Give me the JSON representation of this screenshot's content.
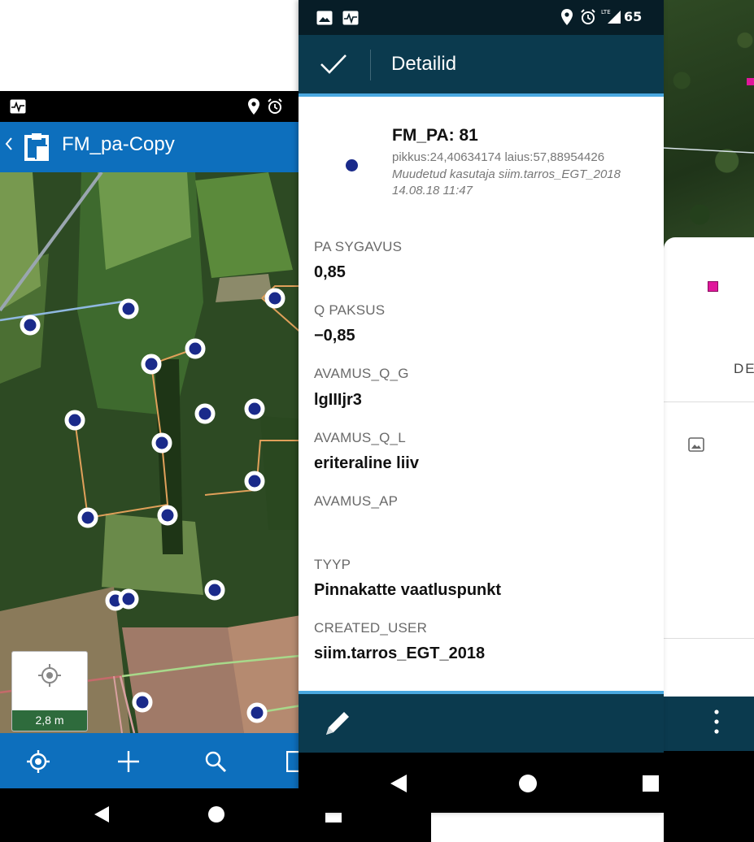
{
  "left_app": {
    "title": "FM_pa-Copy",
    "scale_label": "2,8 m",
    "icons": [
      "locate-icon",
      "plus-icon",
      "search-icon",
      "layers-icon"
    ]
  },
  "middle_app": {
    "status_battery": "65",
    "title": "Detailid",
    "feature": {
      "name": "FM_PA: 81",
      "coords": "pikkus:24,40634174 laius:57,88954426",
      "edited_by": "Muudetud kasutaja siim.tarros_EGT_2018",
      "edited_at": "14.08.18 11:47"
    },
    "fields": [
      {
        "label": "PA SYGAVUS",
        "value": "0,85"
      },
      {
        "label": "Q PAKSUS",
        "value": "−0,85"
      },
      {
        "label": "AVAMUS_Q_G",
        "value": "lgIIIjr3"
      },
      {
        "label": "AVAMUS_Q_L",
        "value": "eriteraline liiv"
      },
      {
        "label": "AVAMUS_AP",
        "value": ""
      },
      {
        "label": "TYYP",
        "value": "Pinnakatte vaatluspunkt"
      },
      {
        "label": "CREATED_USER",
        "value": "siim.tarros_EGT_2018"
      }
    ]
  },
  "right_app": {
    "partial_tab_label": "DE"
  },
  "colors": {
    "left_blue": "#0d6fbd",
    "dark_teal": "#0b3a4e",
    "accent_line": "#4aa8e0",
    "point_navy": "#1a2a8a",
    "magenta_point": "#e0179c",
    "line_orange": "#e0a05a"
  }
}
